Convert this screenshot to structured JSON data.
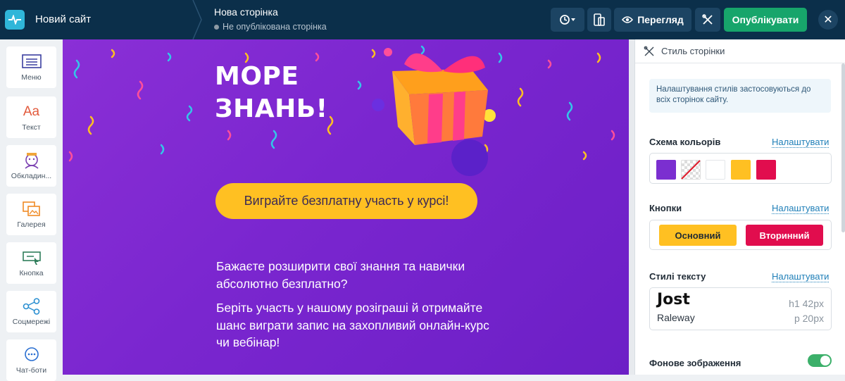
{
  "topbar": {
    "site_name": "Новий сайт",
    "page_name": "Нова сторінка",
    "page_status": "Не опублікована сторінка",
    "preview_label": "Перегляд",
    "publish_label": "Опублікувати"
  },
  "sidebar": {
    "items": [
      {
        "label": "Меню",
        "icon": "menu-icon"
      },
      {
        "label": "Текст",
        "icon": "text-icon"
      },
      {
        "label": "Обкладин...",
        "icon": "cover-icon"
      },
      {
        "label": "Галерея",
        "icon": "gallery-icon"
      },
      {
        "label": "Кнопка",
        "icon": "button-icon"
      },
      {
        "label": "Соцмережі",
        "icon": "share-icon"
      },
      {
        "label": "Чат-боти",
        "icon": "chatbot-icon"
      }
    ]
  },
  "canvas": {
    "title_line1": "МОРЕ",
    "title_line2": "ЗНАНЬ!",
    "cta_label": "Виграйте безплатну участь у курсі!",
    "paragraph1": "Бажаєте розширити свої знання та навички абсолютно безплатно?",
    "paragraph2": "Беріть участь у нашому розіграші й отримайте шанс виграти запис на захопливий онлайн-курс чи вебінар!"
  },
  "panel": {
    "title": "Стиль сторінки",
    "info": "Налаштування стилів застосовуються до всіх сторінок сайту.",
    "colors": {
      "title": "Схема кольорів",
      "link": "Налаштувати",
      "swatches": [
        "#7b2fd0",
        "transparent",
        "#ffffff",
        "#ffc022",
        "#e10d4e"
      ]
    },
    "buttons": {
      "title": "Кнопки",
      "link": "Налаштувати",
      "primary": "Основний",
      "secondary": "Вторинний"
    },
    "text_styles": {
      "title": "Стилі тексту",
      "link": "Налаштувати",
      "heading_font": "Jost",
      "heading_size": "h1  42px",
      "body_font": "Raleway",
      "body_size": "p  20px"
    },
    "background": {
      "title": "Фонове зображення",
      "enabled": true
    }
  }
}
